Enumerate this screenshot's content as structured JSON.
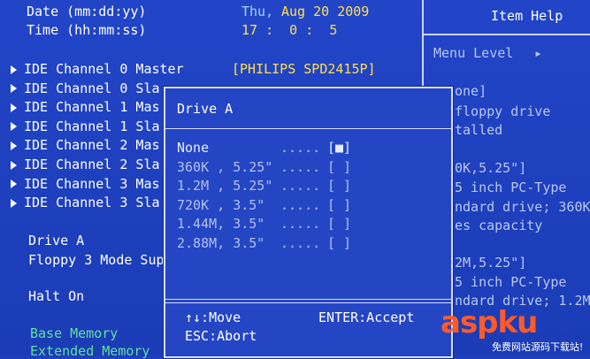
{
  "main": {
    "date_label": "Date (mm:dd:yy)",
    "date_day": "Thu,",
    "date_value": "Aug 20 2009",
    "time_label": "Time (hh:mm:ss)",
    "time_value": "17 :  0 :  5",
    "ide_items": [
      {
        "label": "IDE Channel 0 Master",
        "value": "[PHILIPS SPD2415P]"
      },
      {
        "label": "IDE Channel 0 Sla"
      },
      {
        "label": "IDE Channel 1 Mas"
      },
      {
        "label": "IDE Channel 1 Sla"
      },
      {
        "label": "IDE Channel 2 Mas"
      },
      {
        "label": "IDE Channel 2 Sla"
      },
      {
        "label": "IDE Channel 3 Mas"
      },
      {
        "label": "IDE Channel 3 Sla"
      }
    ],
    "drive_a": "Drive A",
    "floppy_mode": "Floppy 3 Mode Sup",
    "halt_on": "Halt On",
    "base_memory": "Base Memory",
    "extended_memory": "Extended Memory"
  },
  "help": {
    "title": "Item Help",
    "menu_level": "Menu Level",
    "lines": [
      "one]",
      "floppy drive",
      "talled",
      "0K,5.25\"]",
      "5 inch PC-Type",
      "ndard drive; 360K",
      "es capacity",
      "2M,5.25\"]",
      "5 inch PC-Type",
      "ndard drive; 1.2M"
    ]
  },
  "popup": {
    "title": "Drive A",
    "options": [
      {
        "label": "None",
        "dots": ".....",
        "box": "[■]",
        "selected": true
      },
      {
        "label": "360K , 5.25\"",
        "dots": ".....",
        "box": "[ ]"
      },
      {
        "label": "1.2M , 5.25\"",
        "dots": ".....",
        "box": "[ ]"
      },
      {
        "label": "720K , 3.5\"",
        "dots": ".....",
        "box": "[ ]"
      },
      {
        "label": "1.44M, 3.5\"",
        "dots": ".....",
        "box": "[ ]"
      },
      {
        "label": "2.88M, 3.5\"",
        "dots": ".....",
        "box": "[ ]"
      }
    ],
    "footer_move": "↑↓:Move",
    "footer_enter": "ENTER:Accept",
    "footer_abort": "ESC:Abort"
  },
  "watermark": {
    "brand": "aspku",
    "sub": "免费网站源码下载站!"
  },
  "colors": {
    "background": "#1f3fbf",
    "highlight": "#ffe04a",
    "popup_border": "#d8deff"
  }
}
